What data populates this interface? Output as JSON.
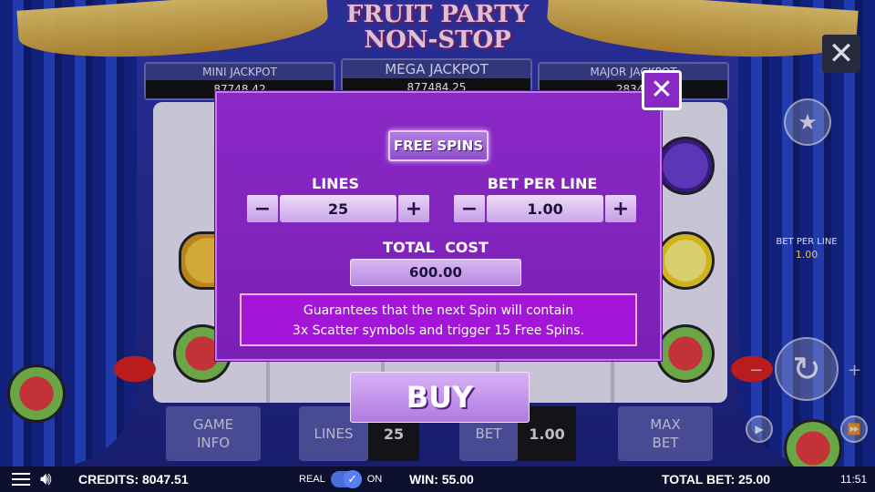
{
  "game": {
    "title_line1": "FRUIT PARTY",
    "title_line2": "NON-STOP",
    "jackpots": [
      {
        "label": "MINI JACKPOT",
        "value": "87748.42"
      },
      {
        "label": "MEGA JACKPOT",
        "value": "877484.25"
      },
      {
        "label": "MAJOR JACKPOT",
        "value": "28348"
      }
    ],
    "side": {
      "bet_per_line_label": "BET PER LINE",
      "bet_per_line_value": "1.00",
      "close_glyph": "✕",
      "star_icon": "star-icon",
      "spin_icon": "spin-icon",
      "minus_glyph": "−",
      "plus_glyph": "+"
    },
    "bottom": {
      "game_info_label": "GAME INFO",
      "lines_label": "LINES",
      "lines_value": "25",
      "bet_label": "BET",
      "bet_value": "1.00",
      "max_bet_label": "MAX BET"
    }
  },
  "dialog": {
    "close_glyph": "✕",
    "tab_label": "FREE SPINS",
    "lines_label": "LINES",
    "lines_value": "25",
    "bet_per_line_label": "BET PER LINE",
    "bet_per_line_value": "1.00",
    "minus_glyph": "−",
    "plus_glyph": "+",
    "total_cost_label": "TOTAL  COST",
    "total_cost_value": "600.00",
    "description_line1": "Guarantees that the next Spin will contain",
    "description_line2": "3x Scatter symbols and trigger 15 Free Spins.",
    "buy_label": "BUY"
  },
  "status_bar": {
    "credits_label": "CREDITS: 8047.51",
    "real_label": "REAL",
    "on_label": "ON",
    "win_label": "WIN: 55.00",
    "total_bet_label": "TOTAL BET: 25.00",
    "time": "11:51"
  },
  "colors": {
    "dialog_bg": "#8a28c6",
    "desc_bg": "#a316d8",
    "status_bg": "#0d0f2e"
  }
}
